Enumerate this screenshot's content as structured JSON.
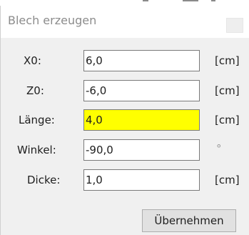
{
  "dialog": {
    "title": "Blech erzeugen"
  },
  "fields": [
    {
      "label": "X0:",
      "value": "6,0",
      "unit": "[cm]"
    },
    {
      "label": "Z0:",
      "value": "-6,0",
      "unit": "[cm]"
    },
    {
      "label": "Länge:",
      "value": "4,0",
      "unit": "[cm]",
      "highlighted": true,
      "highlight_color": "#ffff00"
    },
    {
      "label": "Winkel:",
      "value": "-90,0",
      "unit": "°"
    },
    {
      "label": "Dicke:",
      "value": "1,0",
      "unit": "[cm]"
    }
  ],
  "actions": {
    "apply_label": "Übernehmen"
  },
  "colors": {
    "client_background": "#f0f0f0",
    "title_text": "#8c8c8c"
  },
  "icons": {
    "close": "close-icon"
  }
}
